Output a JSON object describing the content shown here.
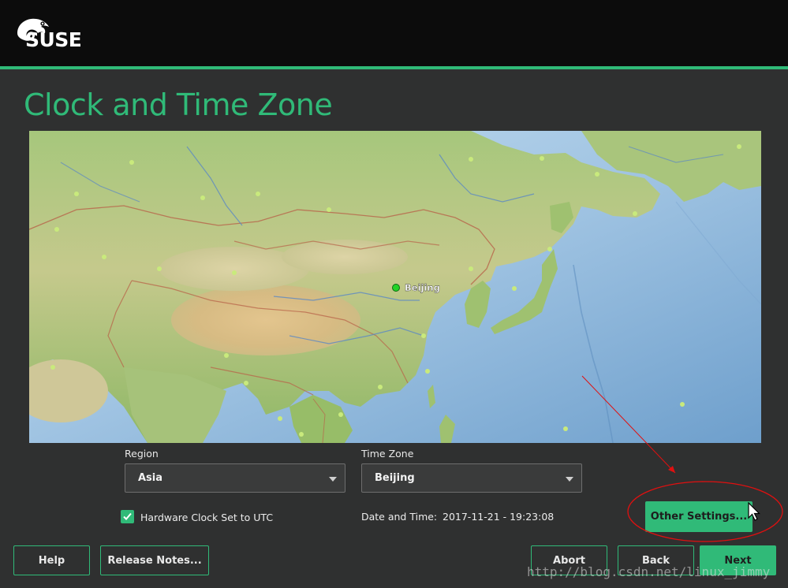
{
  "header": {
    "brand": "SUSE"
  },
  "page": {
    "title": "Clock and Time Zone"
  },
  "map": {
    "selected_city": "Beijing"
  },
  "region": {
    "label": "Region",
    "value": "Asia"
  },
  "timezone": {
    "label": "Time Zone",
    "value": "Beijing"
  },
  "hardware_clock": {
    "label": "Hardware Clock Set to UTC",
    "checked": true
  },
  "datetime": {
    "label": "Date and Time:",
    "value": "2017-11-21 - 19:23:08"
  },
  "buttons": {
    "other_settings": "Other Settings...",
    "help": "Help",
    "release_notes": "Release Notes...",
    "abort": "Abort",
    "back": "Back",
    "next": "Next"
  },
  "watermark": "http://blog.csdn.net/linux_jimmy",
  "colors": {
    "accent": "#30ba78",
    "header_bg": "#0c0c0c",
    "body_bg": "#2f3030",
    "annotation": "#e01010"
  }
}
